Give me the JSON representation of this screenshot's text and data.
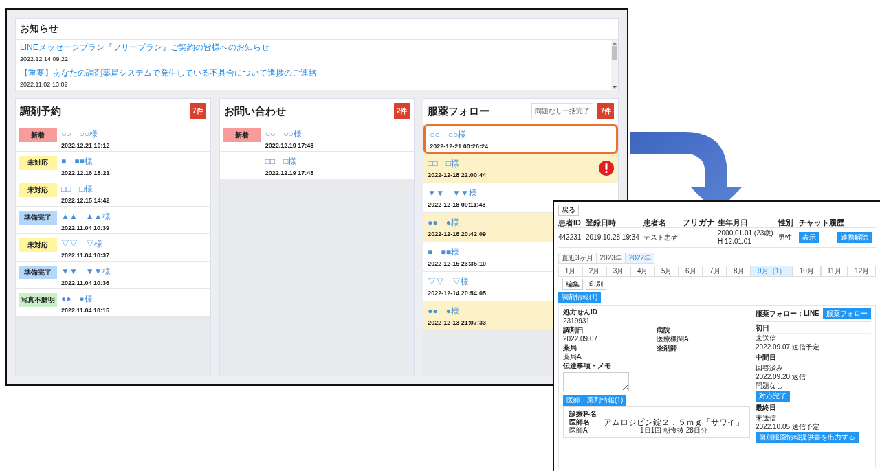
{
  "notices": {
    "title": "お知らせ",
    "items": [
      {
        "title": "LINEメッセージプラン『フリープラン』ご契約の皆様へのお知らせ",
        "date": "2022.12.14 09:22"
      },
      {
        "title": "【重要】あなたの調剤薬局システムで発生している不具合について進捗のご連絡",
        "date": "2022.11.02 13:02"
      }
    ]
  },
  "reservations": {
    "title": "調剤予約",
    "count": "7件",
    "items": [
      {
        "status": "新着",
        "color": "#f79b9b",
        "name": "○○　○○様",
        "date": "2022.12.21 10:12"
      },
      {
        "status": "未対応",
        "color": "#fff59d",
        "name": "■　■■様",
        "date": "2022.12.16 18:21"
      },
      {
        "status": "未対応",
        "color": "#fff59d",
        "name": "□□　□様",
        "date": "2022.12.15 14:42"
      },
      {
        "status": "準備完了",
        "color": "#b3d7fb",
        "name": "▲▲　▲▲様",
        "date": "2022.11.04 10:39"
      },
      {
        "status": "未対応",
        "color": "#fff59d",
        "name": "▽▽　▽様",
        "date": "2022.11.04 10:37"
      },
      {
        "status": "準備完了",
        "color": "#b3d7fb",
        "name": "▼▼　▼▼様",
        "date": "2022.11.04 10:36"
      },
      {
        "status": "写真不鮮明",
        "color": "#c8efc8",
        "name": "●●　●様",
        "date": "2022.11.04 10:15"
      }
    ]
  },
  "inquiries": {
    "title": "お問い合わせ",
    "count": "2件",
    "items": [
      {
        "status": "新着",
        "color": "#f79b9b",
        "name": "○○　○○様",
        "date": "2022.12.19 17:48"
      },
      {
        "name": "□□　□様",
        "date": "2022.12.19 17:48"
      }
    ]
  },
  "follow": {
    "title": "服薬フォロー",
    "bulk_button": "問題なし一括完了",
    "count": "7件",
    "items": [
      {
        "name": "○○　○○様",
        "date": "2022-12-21 00:26:24",
        "flagged": false,
        "highlighted": true
      },
      {
        "name": "□□　□様",
        "date": "2022-12-18 22:00:44",
        "flagged": true,
        "highlighted": false
      },
      {
        "name": "▼▼　▼▼様",
        "date": "2022-12-18 00:11:43",
        "flagged": false,
        "highlighted": false
      },
      {
        "name": "●●　●様",
        "date": "2022-12-16 20:42:09",
        "flagged": true,
        "highlighted": false
      },
      {
        "name": "■　■■様",
        "date": "2022-12-15 23:35:10",
        "flagged": false,
        "highlighted": false
      },
      {
        "name": "▽▽　▽様",
        "date": "2022-12-14 20:54:05",
        "flagged": false,
        "highlighted": false
      },
      {
        "name": "●●　●様",
        "date": "2022-12-13 21:07:33",
        "flagged": true,
        "highlighted": false
      }
    ]
  },
  "detail": {
    "back_button": "戻る",
    "patient_table": {
      "columns": [
        "患者ID",
        "登録日時",
        "患者名",
        "フリガナ",
        "生年月日",
        "性別",
        "チャット履歴"
      ],
      "row": {
        "id": "442231",
        "registered": "2019.10.28 19:34",
        "name": "テスト患者",
        "birth": [
          "2000.01.01 (23歳)",
          "H 12.01.01"
        ],
        "sex": "男性",
        "chat_button": "表示",
        "unlink_button": "連携解除"
      }
    },
    "year_tabs": [
      {
        "label": "直近3ヶ月",
        "selected": false
      },
      {
        "label": "2023年",
        "selected": false
      },
      {
        "label": "2022年",
        "selected": true
      }
    ],
    "month_tabs": [
      {
        "label": "1月",
        "selected": false
      },
      {
        "label": "2月",
        "selected": false
      },
      {
        "label": "3月",
        "selected": false
      },
      {
        "label": "4月",
        "selected": false
      },
      {
        "label": "5月",
        "selected": false
      },
      {
        "label": "6月",
        "selected": false
      },
      {
        "label": "7月",
        "selected": false
      },
      {
        "label": "8月",
        "selected": false
      },
      {
        "label": "9月（1）",
        "selected": true
      },
      {
        "label": "10月",
        "selected": false
      },
      {
        "label": "11月",
        "selected": false
      },
      {
        "label": "12月",
        "selected": false
      }
    ],
    "actions": [
      "編集",
      "印刷"
    ],
    "dispense_tab": "調剤情報(1)",
    "fields": [
      {
        "label": "処方せんID",
        "value": "2319931"
      },
      {
        "label": "調剤日",
        "value": "2022.09.07"
      },
      {
        "label": "病院",
        "value": "医療機関A"
      },
      {
        "label": "薬局",
        "value": "薬局A"
      },
      {
        "label": "薬剤師"
      }
    ],
    "memo_label": "伝達事項・メモ",
    "doctor_tab": "医師・薬剤情報(1)",
    "doctor": {
      "dept_label": "診療科名",
      "doctor_label": "医師名",
      "doctor_value": "医師A",
      "drug": "アムロジピン錠２．５ｍｇ「サワイ」",
      "dosage": "1日1回 朝食後 28日分"
    },
    "follow_panel": {
      "title": "服薬フォロー：LINE",
      "button": "服薬フォロー",
      "stages": [
        {
          "title": "初日",
          "lines": [
            "未送信",
            "2022.09.07 送信予定"
          ]
        },
        {
          "title": "中間日",
          "lines": [
            "回答済み",
            "2022.09.20 返信",
            "問題なし"
          ],
          "button": "対応完了"
        },
        {
          "title": "最終日",
          "lines": [
            "未送信",
            "2022.10.05 送信予定"
          ],
          "button": "個別服薬情報提供書を出力する"
        }
      ]
    }
  }
}
